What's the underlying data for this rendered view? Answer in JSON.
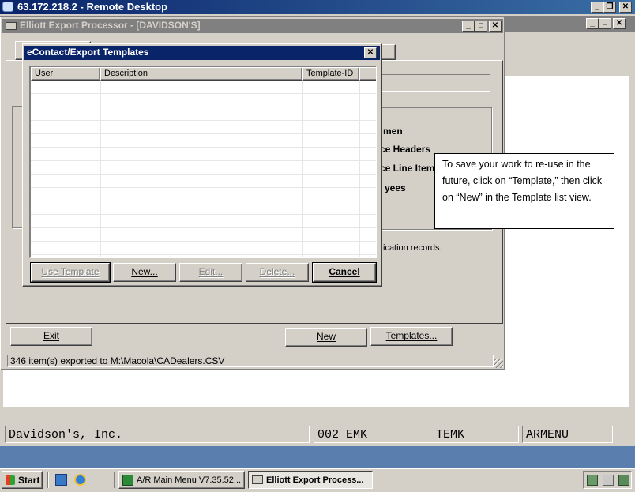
{
  "rdp": {
    "title": "63.172.218.2 - Remote Desktop"
  },
  "export_window": {
    "title": "Elliott Export Processor - [DAVIDSON'S]",
    "bg_labels": [
      "men",
      "ce Headers",
      "ce Line Item",
      "yees"
    ],
    "bg_note": "ication records.",
    "exit_label": "Exit",
    "new_label": "New",
    "templates_label": "Templates...",
    "status": "346 item(s) exported to M:\\Macola\\CADealers.CSV"
  },
  "dialog": {
    "title": "eContact/Export Templates",
    "columns": [
      "User",
      "Description",
      "Template-ID"
    ],
    "buttons": {
      "use_template": "Use Template",
      "new": "New...",
      "edit": "Edit...",
      "delete": "Delete...",
      "cancel": "Cancel"
    }
  },
  "callout": {
    "text": "To save your work to re-use in the future, click on “Template,” then click on “New” in the Template list view."
  },
  "main_status": {
    "company": "Davidson's, Inc.",
    "code": "002 EMK",
    "user": "TEMK",
    "menu": "ARMENU"
  },
  "taskbar": {
    "start": "Start",
    "items": [
      "A/R Main Menu V7.35.52...",
      "Elliott Export Process..."
    ]
  }
}
